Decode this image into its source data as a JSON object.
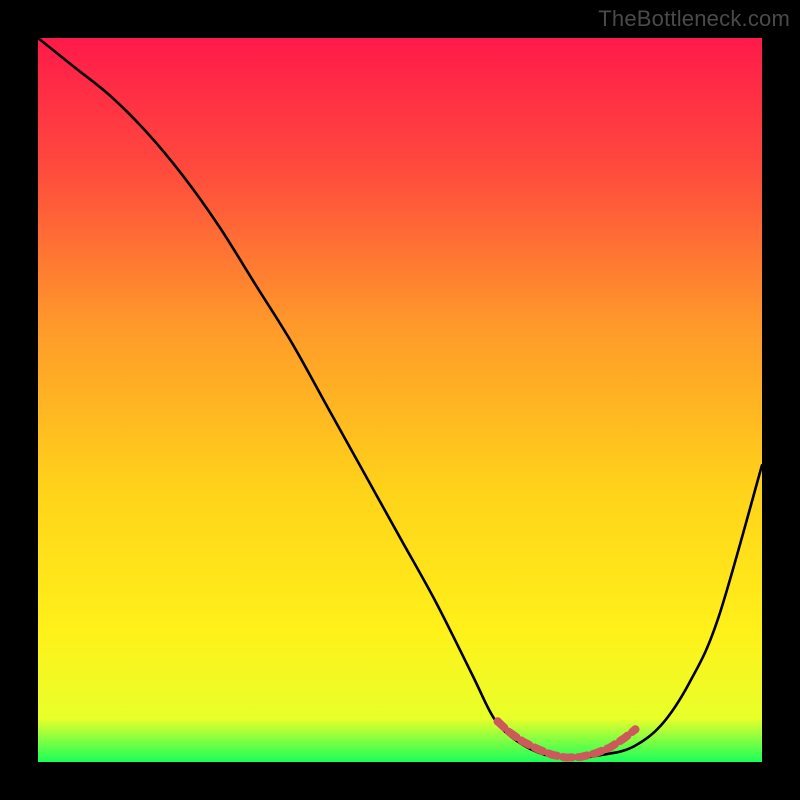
{
  "watermark": "TheBottleneck.com",
  "chart_data": {
    "type": "line",
    "title": "",
    "xlabel": "",
    "ylabel": "",
    "xlim": [
      0,
      100
    ],
    "ylim": [
      0,
      100
    ],
    "grid": false,
    "legend": false,
    "background_gradient_stops": [
      {
        "offset": 0.0,
        "color": "#ff1a4a"
      },
      {
        "offset": 0.18,
        "color": "#ff4a3d"
      },
      {
        "offset": 0.4,
        "color": "#ff9a2a"
      },
      {
        "offset": 0.62,
        "color": "#ffd21a"
      },
      {
        "offset": 0.82,
        "color": "#fff11a"
      },
      {
        "offset": 0.94,
        "color": "#e8ff2a"
      },
      {
        "offset": 1.0,
        "color": "#1aff5a"
      }
    ],
    "series": [
      {
        "name": "bottleneck-curve",
        "x": [
          0,
          5,
          10,
          15,
          20,
          25,
          30,
          35,
          40,
          45,
          50,
          55,
          60,
          63,
          66,
          70,
          74,
          78,
          82,
          86,
          90,
          94,
          100
        ],
        "y": [
          100,
          96,
          92,
          87,
          81,
          74,
          66,
          58,
          49,
          40,
          31,
          22,
          12,
          6,
          3,
          1,
          0.5,
          1,
          2,
          5,
          11,
          20,
          41
        ],
        "color": "#000000",
        "stroke_width": 2.6
      }
    ],
    "markers": {
      "name": "highlight-region",
      "color": "#cc5a5a",
      "points_x": [
        63.5,
        65,
        67,
        69,
        71,
        73,
        75,
        77,
        79,
        81,
        82.5
      ],
      "points_y": [
        5.6,
        4.2,
        2.8,
        1.8,
        1.0,
        0.6,
        0.7,
        1.2,
        2.0,
        3.3,
        4.5
      ],
      "radius": 4.2
    }
  }
}
